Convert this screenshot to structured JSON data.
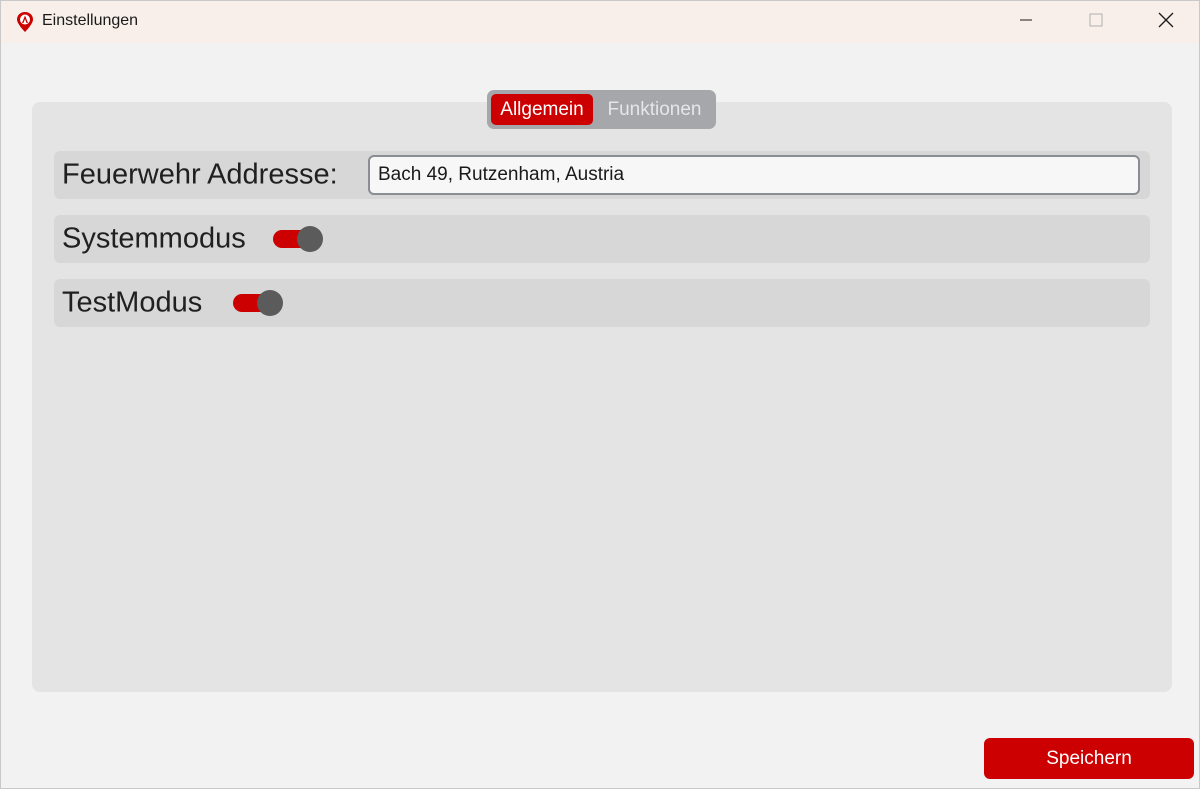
{
  "window": {
    "title": "Einstellungen",
    "icon": "fire-brigade-icon",
    "controls": [
      "minimize-icon",
      "maximize-icon",
      "close-icon"
    ]
  },
  "tabs": [
    {
      "label": "Allgemein",
      "active": true
    },
    {
      "label": "Funktionen",
      "active": false
    }
  ],
  "settings": {
    "address": {
      "label": "Feuerwehr Addresse:",
      "value": "Bach 49, Rutzenham, Austria"
    },
    "systemmodus": {
      "label": "Systemmodus",
      "on": true
    },
    "testmodus": {
      "label": "TestModus",
      "on": true
    }
  },
  "footer": {
    "save_label": "Speichern"
  },
  "colors": {
    "accent": "#cc0000",
    "titlebar": "#f8efea",
    "panel": "#e4e4e4",
    "row": "#d7d7d7",
    "tabbar": "#a5a7ab"
  }
}
